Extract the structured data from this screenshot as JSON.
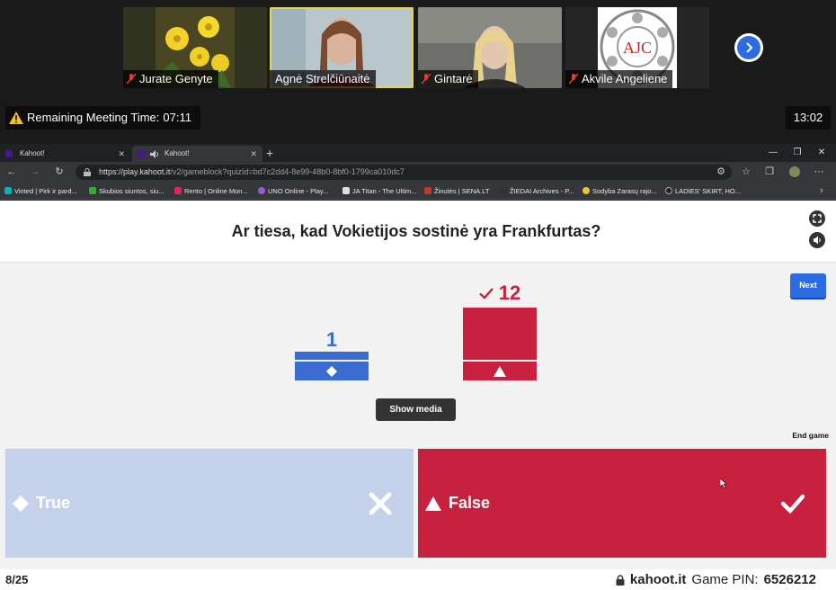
{
  "meeting": {
    "participants": [
      {
        "name": "Jurate Genyte"
      },
      {
        "name": "Agnė Strelčiūnaitė"
      },
      {
        "name": "Gintarė"
      },
      {
        "name": "Akvile Angeliene"
      }
    ],
    "remaining_label": "Remaining Meeting Time:",
    "remaining_time": "07:11",
    "clock": "13:02"
  },
  "browser": {
    "tabs": [
      {
        "label": "Kahoot!"
      },
      {
        "label": "Kahoot!"
      }
    ],
    "url_host": "https://play.kahoot.it",
    "url_path": "/v2/gameblock?quizId=bd7c2dd4-8e99-48b0-8bf0-1799ca010dc7",
    "bookmarks": [
      {
        "label": "Vinted | Pirk ir pard...",
        "color": "#09b1ba"
      },
      {
        "label": "Skubios siuntos, siu...",
        "color": "#3aaa35"
      },
      {
        "label": "Rento | Online Mon...",
        "color": "#e0245e"
      },
      {
        "label": "UNO Online - Play...",
        "color": "#9b59d0"
      },
      {
        "label": "JA Titan - The Ultim...",
        "color": "#dddddd"
      },
      {
        "label": "Žinutės | SENA.LT",
        "color": "#c0392b"
      },
      {
        "label": "ŽIEDAI Archives - P...",
        "color": "#333333"
      },
      {
        "label": "Sodyba Zarasų rajo...",
        "color": "#e8c43a"
      },
      {
        "label": "LADIES' SKIRT, HO...",
        "color": "#222222"
      }
    ]
  },
  "kahoot": {
    "question": "Ar tiesa, kad Vokietijos sostinė yra Frankfurtas?",
    "next_label": "Next",
    "show_media_label": "Show media",
    "end_game_label": "End game",
    "results": [
      {
        "count": "1",
        "votes": 1,
        "color": "#3b6ccf",
        "shape": "diamond-icon",
        "correct": false
      },
      {
        "count": "12",
        "votes": 12,
        "color": "#c8203f",
        "shape": "triangle-icon",
        "correct": true
      }
    ],
    "answers": [
      {
        "label": "True",
        "color": "#c3d1ea",
        "shape": "diamond-icon",
        "mark": "cross-icon"
      },
      {
        "label": "False",
        "color": "#c8203f",
        "shape": "triangle-icon",
        "mark": "check-icon"
      }
    ],
    "progress": "8/25",
    "site": "kahoot.it",
    "pin_label": "Game PIN:",
    "pin": "6526212"
  },
  "colors": {
    "accent_blue": "#2d6be0",
    "highlight_yellow": "#e6d44e"
  }
}
